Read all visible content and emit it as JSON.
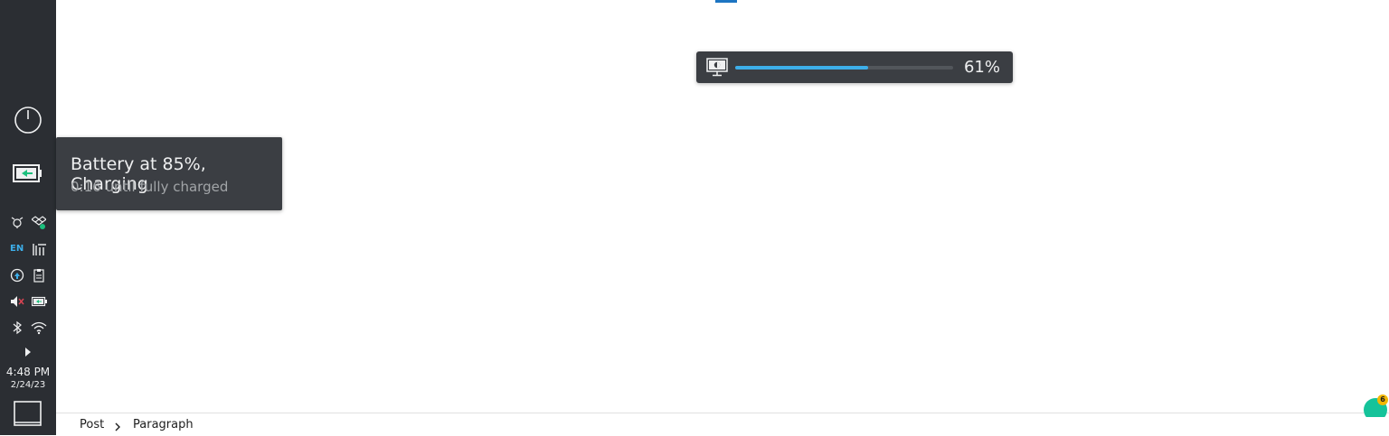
{
  "panel": {
    "clock_time": "4:48 PM",
    "clock_date": "2/24/23",
    "keyboard_layout": "EN",
    "icons": [
      "power-icon",
      "battery-charging-icon",
      "alarm-icon",
      "dropbox-icon",
      "keyboard-layout-indicator",
      "audio-mixer-icon",
      "update-icon",
      "clipboard-icon",
      "volume-muted-icon",
      "battery-small-icon",
      "bluetooth-icon",
      "wifi-icon",
      "expand-tray-arrow-icon",
      "show-desktop-icon"
    ]
  },
  "tooltip": {
    "title": "Battery at 85%, Charging",
    "subtitle": "0:16 until fully charged"
  },
  "osd": {
    "icon": "display-brightness-icon",
    "value_text": "61%",
    "level": 0.61
  },
  "breadcrumb": {
    "items": [
      "Post",
      "Paragraph"
    ]
  },
  "grammarly": {
    "badge_count": "6"
  },
  "colors": {
    "panel_bg": "#2b2e33",
    "tooltip_bg": "#3b3e43",
    "accent": "#3daee9",
    "battery_green": "#1cc07e"
  }
}
